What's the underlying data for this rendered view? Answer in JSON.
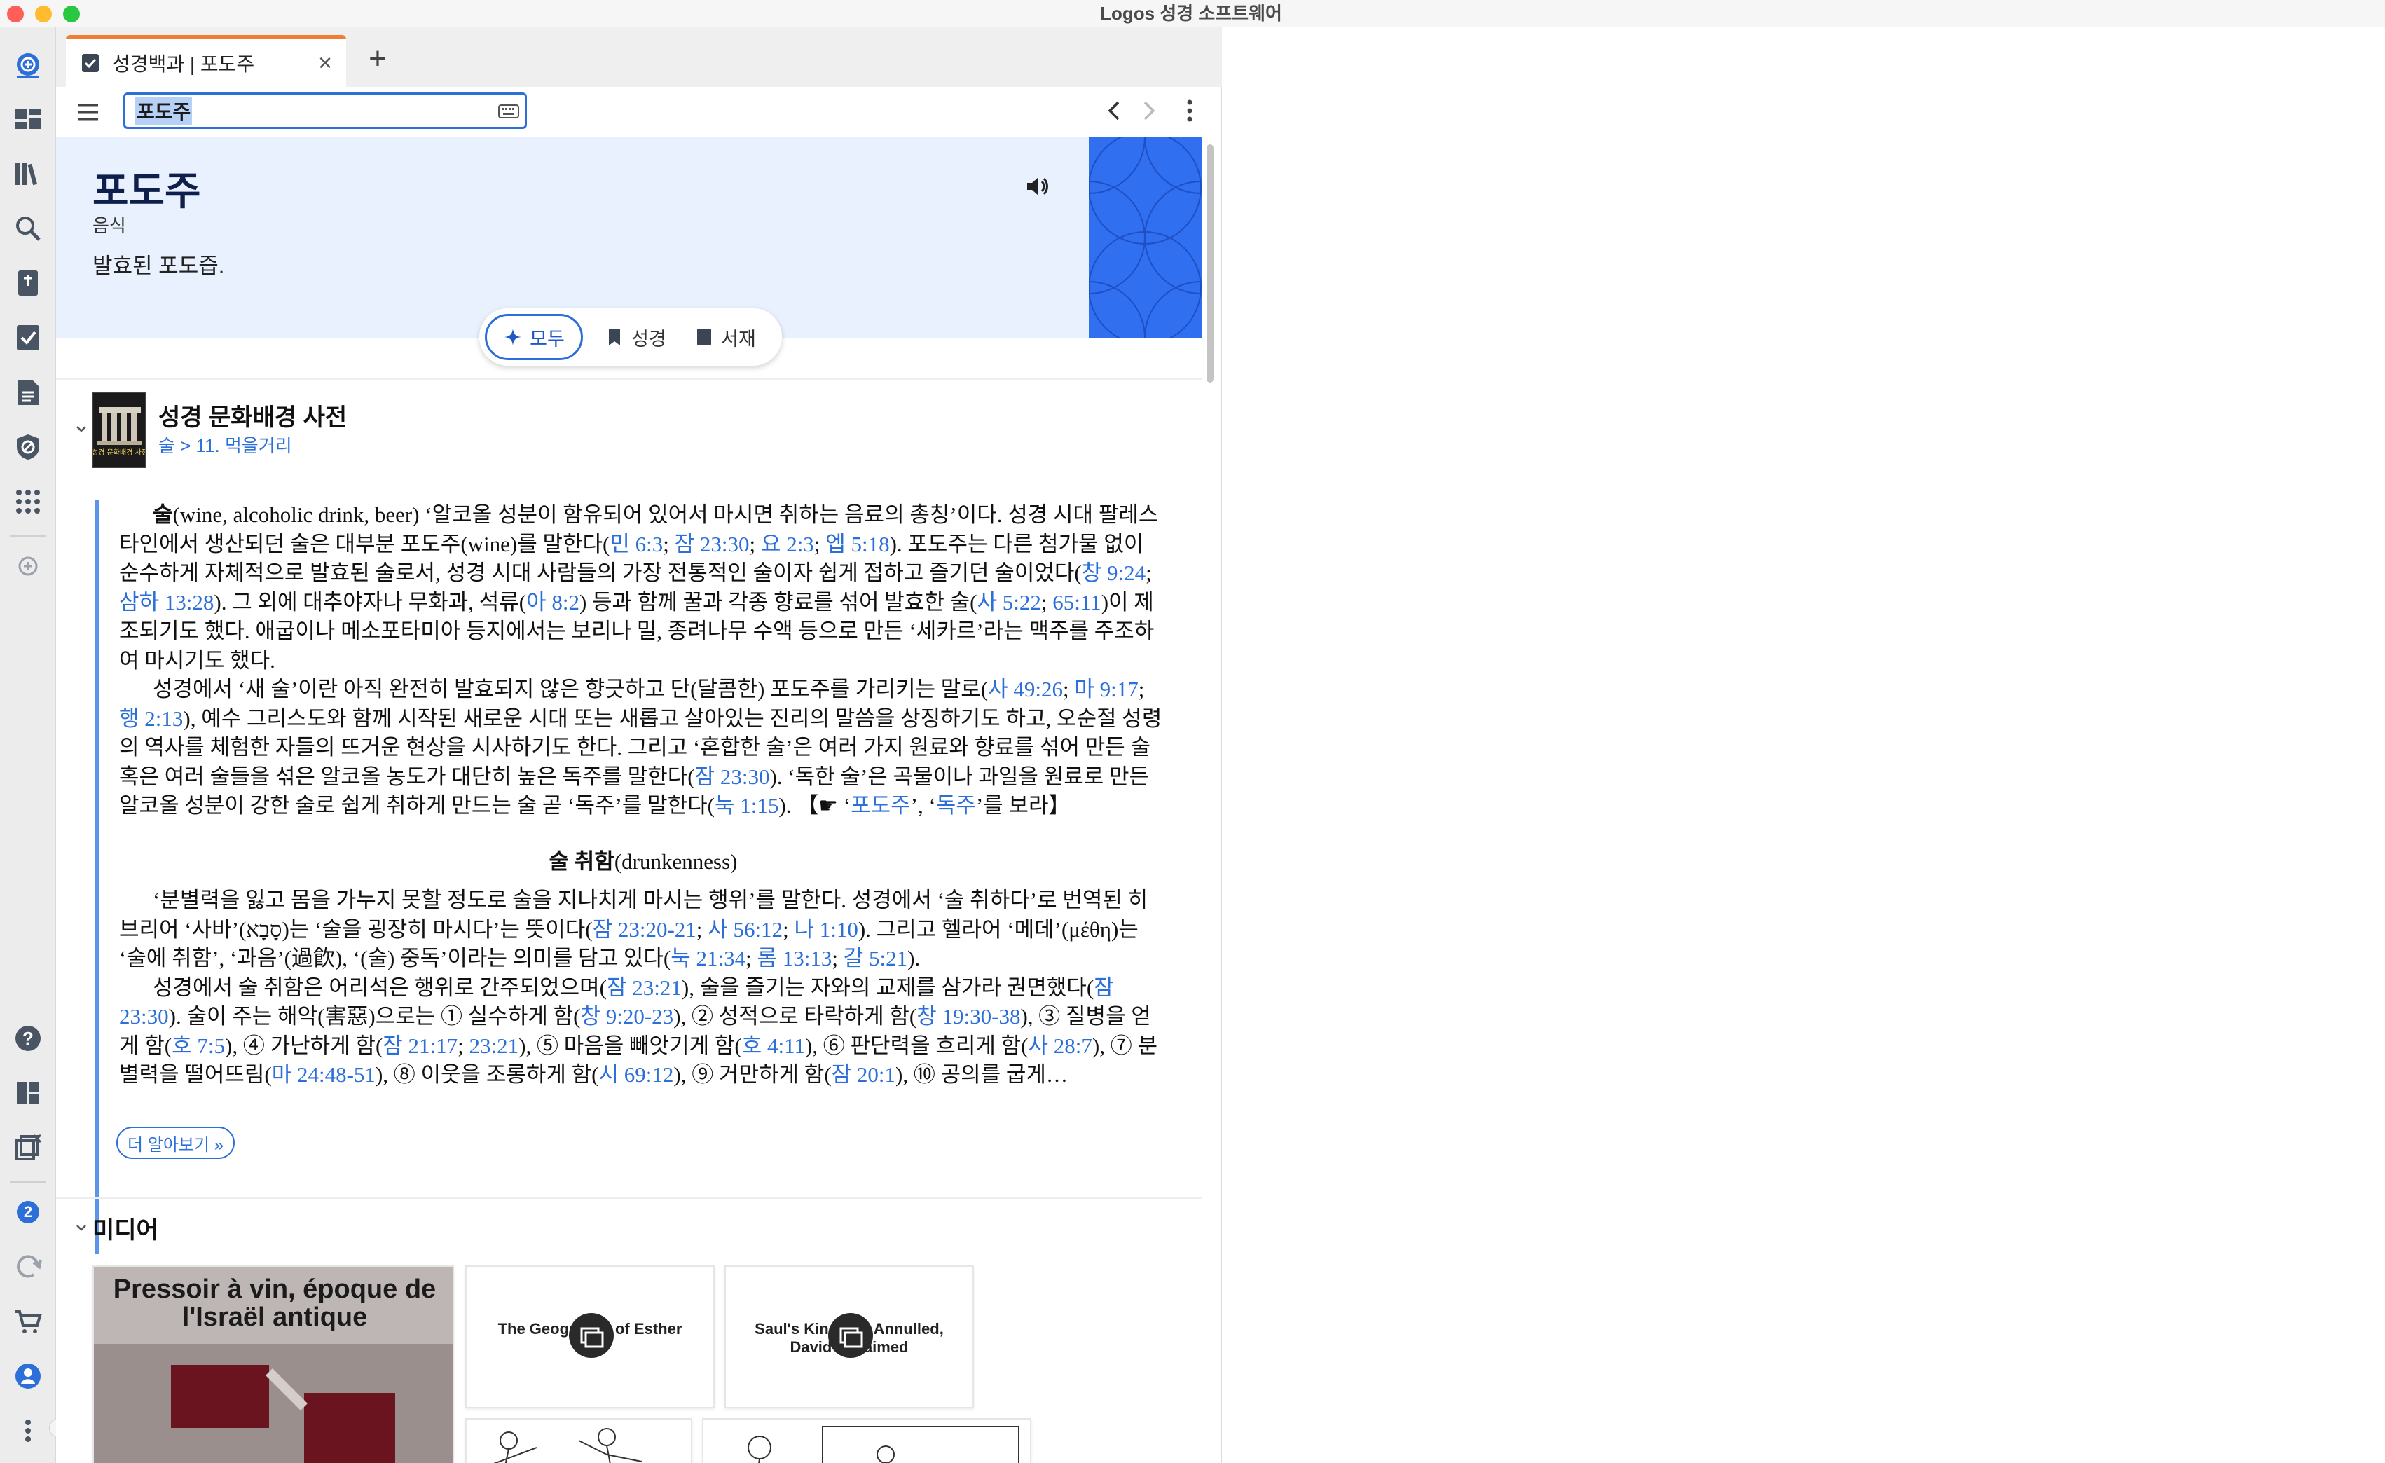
{
  "app": {
    "title": "Logos 성경 소프트웨어"
  },
  "tabs": [
    {
      "label": "성경백과 | 포도주"
    }
  ],
  "toolbar": {
    "add_tab": "+",
    "close_tab": "×",
    "notification_count": "2"
  },
  "search": {
    "value": "포도주"
  },
  "entry": {
    "term": "포도주",
    "category": "음식",
    "definition": "발효된 포도즙."
  },
  "filters": {
    "all": "모두",
    "bible": "성경",
    "library": "서재"
  },
  "article": {
    "source_title": "성경 문화배경 사전",
    "crumb": "술 > 11. 먹을거리",
    "cover_text": "성경 문화배경 사전",
    "subheading_ko": "술 취함",
    "subheading_en": "(drunkenness)",
    "learn_more": "더 알아보기 »"
  },
  "media": {
    "section_title": "미디어",
    "items": [
      {
        "title": "Pressoir à vin, époque de l'Israël antique"
      },
      {
        "title": "The Geography of Esther"
      },
      {
        "title": "Saul's Kingship Annulled, David's Claimed"
      }
    ]
  },
  "colors": {
    "accent": "#2c6fd8",
    "tab_accent": "#f07d32",
    "header_bg": "#e8f1fd",
    "header_art": "#2f6ff0"
  }
}
